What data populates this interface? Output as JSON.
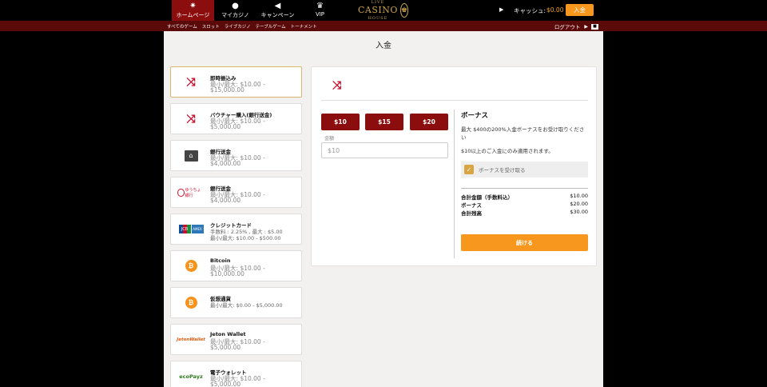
{
  "nav": {
    "items": [
      {
        "icon": "home-icon",
        "glyph": "✷",
        "label": "ホームページ"
      },
      {
        "icon": "user-icon",
        "glyph": "●",
        "label": "マイカジノ"
      },
      {
        "icon": "megaphone-icon",
        "glyph": "◀",
        "label": "キャンペーン"
      },
      {
        "icon": "crown-icon",
        "glyph": "♛",
        "label": "VIP"
      }
    ],
    "logo": {
      "small": "LIVE",
      "main": "CASINO",
      "sub": "HOUSE"
    },
    "cash_label": "キャッシュ:",
    "cash_value": "$0.00",
    "deposit_label": "入金"
  },
  "subnav": {
    "links": [
      "すべてのゲーム",
      "スロット",
      "ライブカジノ",
      "テーブルゲーム",
      "トーナメント"
    ],
    "logout": "ログアウト"
  },
  "page": {
    "title": "入金"
  },
  "methods": [
    {
      "icon": "shuffle-icon",
      "name": "即時振込み",
      "line1": "最小/最大: $10.00 -",
      "line2": "$15,000.00"
    },
    {
      "icon": "shuffle-icon",
      "name": "バウチャー購入(銀行送金)",
      "line1": "最小/最大: $10.00 -",
      "line2": "$5,000.00"
    },
    {
      "icon": "bank-icon",
      "name": "銀行送金",
      "line1": "最小/最大: $10.00 -",
      "line2": "$4,000.00"
    },
    {
      "icon": "japan-post-bank-icon",
      "name": "銀行送金",
      "line1": "最小/最大: $10.00 -",
      "line2": "$4,000.00",
      "logo_text": "ゆうちょ銀行"
    },
    {
      "icon": "credit-card-icon",
      "name": "クレジットカード",
      "line1": "手数料 : 2.25% , 最大 : $5.00",
      "line2": "最小/最大: $10.00 - $500.00",
      "logo_text": "JCB",
      "logo_text2": "AMEX"
    },
    {
      "icon": "bitcoin-icon",
      "name": "Bitcoin",
      "line1": "最小/最大: $10.00 -",
      "line2": "$10,000.00"
    },
    {
      "icon": "bitcoin-icon",
      "name": "仮想通貨",
      "line1": "最小/最大: $0.00 - $5,000.00",
      "line2": ""
    },
    {
      "icon": "jeton-wallet-icon",
      "name": "Jeton Wallet",
      "line1": "最小/最大: $10.00 -",
      "line2": "$5,000.00",
      "logo_text": "JetonWallet"
    },
    {
      "icon": "ecopayz-icon",
      "name": "電子ウォレット",
      "line1": "最小/最大: $10.00 -",
      "line2": "$5,000.00",
      "logo_text": "ecoPayz"
    }
  ],
  "form": {
    "amount_buttons": [
      "$10",
      "$15",
      "$20"
    ],
    "amount_label": "金額",
    "amount_value": "$10",
    "bonus": {
      "title": "ボーナス",
      "desc": "最大 $400の200%入金ボーナスをお受け取りください",
      "note": "$10以上のご入金にのみ適用されます。",
      "checkbox_label": "ボーナスを受け取る",
      "checked": true
    },
    "summary": [
      {
        "label": "合計金額（手数料込）",
        "value": "$10.00"
      },
      {
        "label": "ボーナス",
        "value": "$20.00"
      },
      {
        "label": "合計残高",
        "value": "$30.00"
      }
    ],
    "continue_label": "続ける"
  },
  "colors": {
    "accent": "#f7971e",
    "dark_red": "#8c0d0d",
    "gold": "#c9a44a"
  }
}
